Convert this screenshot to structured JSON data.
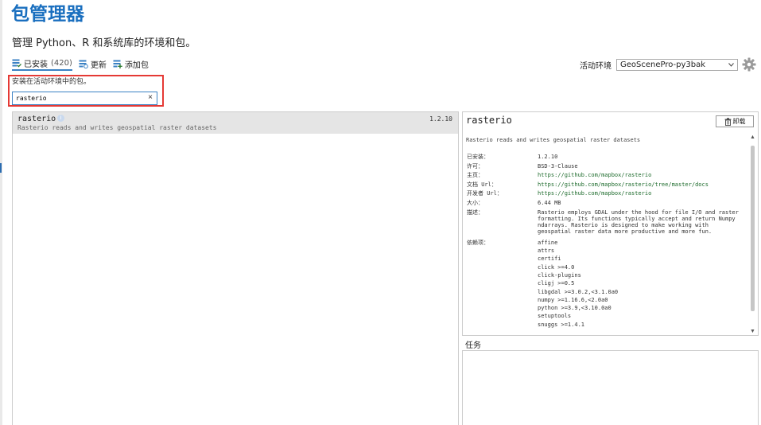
{
  "header": {
    "title": "包管理器",
    "subtitle": "管理 Python、R 和系统库的环境和包。"
  },
  "tabs": [
    {
      "label": "已安装",
      "count": "(420)",
      "icon": "installed-list-icon",
      "active": true
    },
    {
      "label": "更新",
      "icon": "update-list-icon",
      "active": false
    },
    {
      "label": "添加包",
      "icon": "add-package-icon",
      "active": false
    }
  ],
  "environment": {
    "label": "活动环境",
    "selected": "GeoScenePro-py3bak"
  },
  "search": {
    "hint": "安装在活动环境中的包。",
    "value": "rasterio",
    "clear": "×"
  },
  "package_list": [
    {
      "name": "rasterio",
      "description": "Rasterio reads and writes geospatial raster datasets",
      "version": "1.2.10"
    }
  ],
  "details": {
    "name": "rasterio",
    "uninstall_label": "卸载",
    "description": "Rasterio reads and writes geospatial raster datasets",
    "installed_label": "已安装：",
    "installed": "1.2.10",
    "license_label": "许可：",
    "license": "BSD-3-Clause",
    "home_label": "主页：",
    "home": "https://github.com/mapbox/rasterio",
    "docs_label": "文档 Url：",
    "docs": "https://github.com/mapbox/rasterio/tree/master/docs",
    "dev_label": "开发者 Url：",
    "dev": "https://github.com/mapbox/rasterio",
    "size_label": "大小：",
    "size": "6.44 MB",
    "summary_label": "描述：",
    "summary": "Rasterio employs GDAL under the hood for file I/O and raster formatting. Its functions typically accept and return Numpy ndarrays. Rasterio is designed to make working with geospatial raster data more productive and more fun.",
    "deps_label": "依赖项：",
    "dependencies": [
      "affine",
      "attrs",
      "certifi",
      "click >=4.0",
      "click-plugins",
      "cligj >=0.5",
      "libgdal >=3.0.2,<3.1.0a0",
      "numpy >=1.16.6,<2.0a0",
      "python >=3.9,<3.10.0a0",
      "setuptools",
      "snuggs >=1.4.1"
    ]
  },
  "tasks": {
    "title": "任务"
  }
}
